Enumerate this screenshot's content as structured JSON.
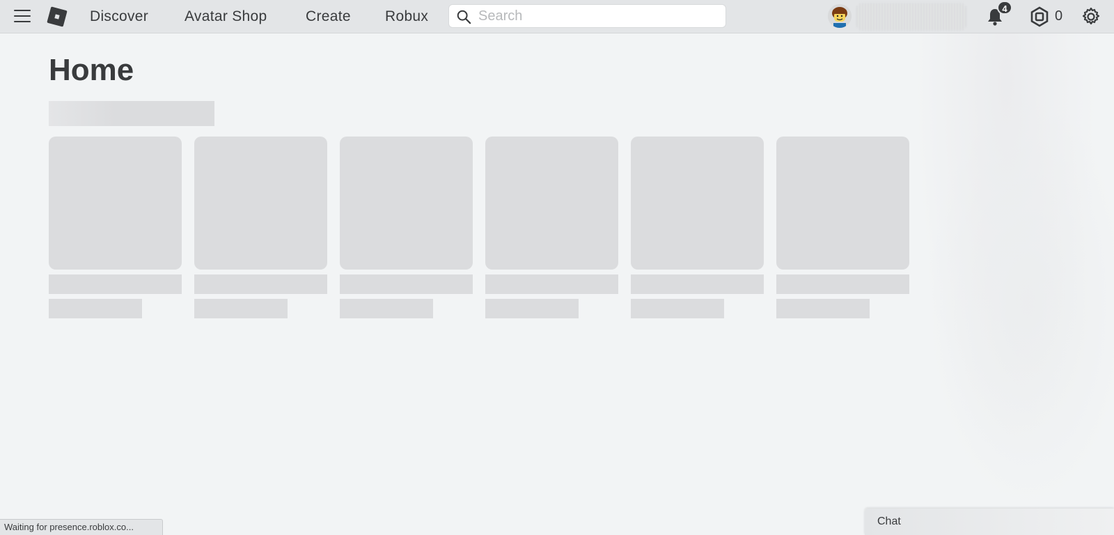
{
  "nav": {
    "links": [
      "Discover",
      "Avatar Shop",
      "Create",
      "Robux"
    ],
    "search_placeholder": "Search",
    "notification_count": "4",
    "robux_balance": "0"
  },
  "main": {
    "title": "Home",
    "placeholder_card_count": 6
  },
  "status_bar": {
    "text": "Waiting for presence.roblox.co..."
  },
  "chat": {
    "label": "Chat"
  },
  "icons": {
    "menu": "hamburger-menu-icon",
    "logo": "roblox-logo",
    "search": "search-icon",
    "notifications": "bell-icon",
    "currency": "robux-icon",
    "settings": "gear-icon"
  },
  "colors": {
    "background": "#f2f4f5",
    "topbar": "#e3e5e7",
    "text": "#393b3d",
    "skeleton": "#dbdcde"
  }
}
